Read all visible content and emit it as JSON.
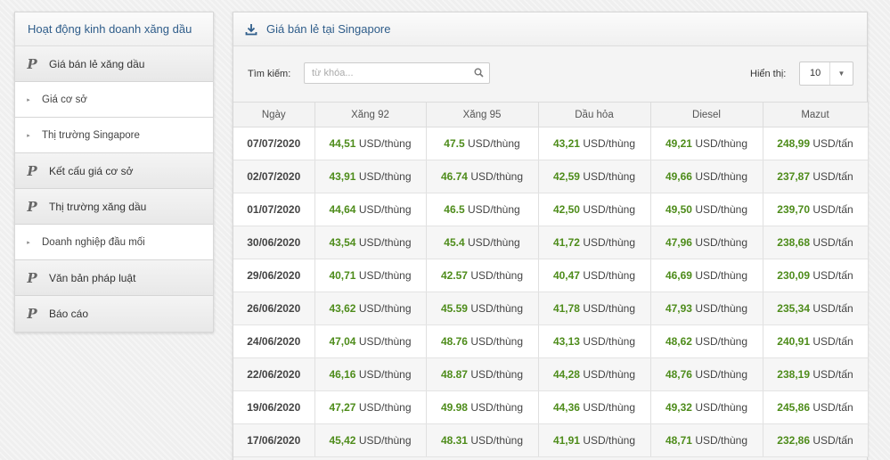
{
  "sidebar": {
    "title": "Hoạt động kinh doanh xăng dầu",
    "items": [
      {
        "type": "main",
        "label": "Giá bán lẻ xăng dầu"
      },
      {
        "type": "sub",
        "label": "Giá cơ sở"
      },
      {
        "type": "sub",
        "label": "Thị trường Singapore"
      },
      {
        "type": "main",
        "label": "Kết cấu giá cơ sở"
      },
      {
        "type": "main",
        "label": "Thị trường xăng dầu"
      },
      {
        "type": "sub",
        "label": "Doanh nghiệp đầu mối"
      },
      {
        "type": "main",
        "label": "Văn bản pháp luật"
      },
      {
        "type": "main",
        "label": "Báo cáo"
      }
    ]
  },
  "panel": {
    "title": "Giá bán lẻ tại Singapore",
    "search_label": "Tìm kiếm:",
    "search_placeholder": "từ khóa...",
    "show_label": "Hiển thị:",
    "show_value": "10"
  },
  "table": {
    "headers": [
      "Ngày",
      "Xăng 92",
      "Xăng 95",
      "Dầu hỏa",
      "Diesel",
      "Mazut"
    ],
    "units": [
      "USD/thùng",
      "USD/thùng",
      "USD/thùng",
      "USD/thùng",
      "USD/tấn"
    ],
    "rows": [
      [
        "07/07/2020",
        "44,51",
        "47.5",
        "43,21",
        "49,21",
        "248,99"
      ],
      [
        "02/07/2020",
        "43,91",
        "46.74",
        "42,59",
        "49,66",
        "237,87"
      ],
      [
        "01/07/2020",
        "44,64",
        "46.5",
        "42,50",
        "49,50",
        "239,70"
      ],
      [
        "30/06/2020",
        "43,54",
        "45.4",
        "41,72",
        "47,96",
        "238,68"
      ],
      [
        "29/06/2020",
        "40,71",
        "42.57",
        "40,47",
        "46,69",
        "230,09"
      ],
      [
        "26/06/2020",
        "43,62",
        "45.59",
        "41,78",
        "47,93",
        "235,34"
      ],
      [
        "24/06/2020",
        "47,04",
        "48.76",
        "43,13",
        "48,62",
        "240,91"
      ],
      [
        "22/06/2020",
        "46,16",
        "48.87",
        "44,28",
        "48,76",
        "238,19"
      ],
      [
        "19/06/2020",
        "47,27",
        "49.98",
        "44,36",
        "49,32",
        "245,86"
      ],
      [
        "17/06/2020",
        "45,42",
        "48.31",
        "41,91",
        "48,71",
        "232,86"
      ]
    ]
  }
}
